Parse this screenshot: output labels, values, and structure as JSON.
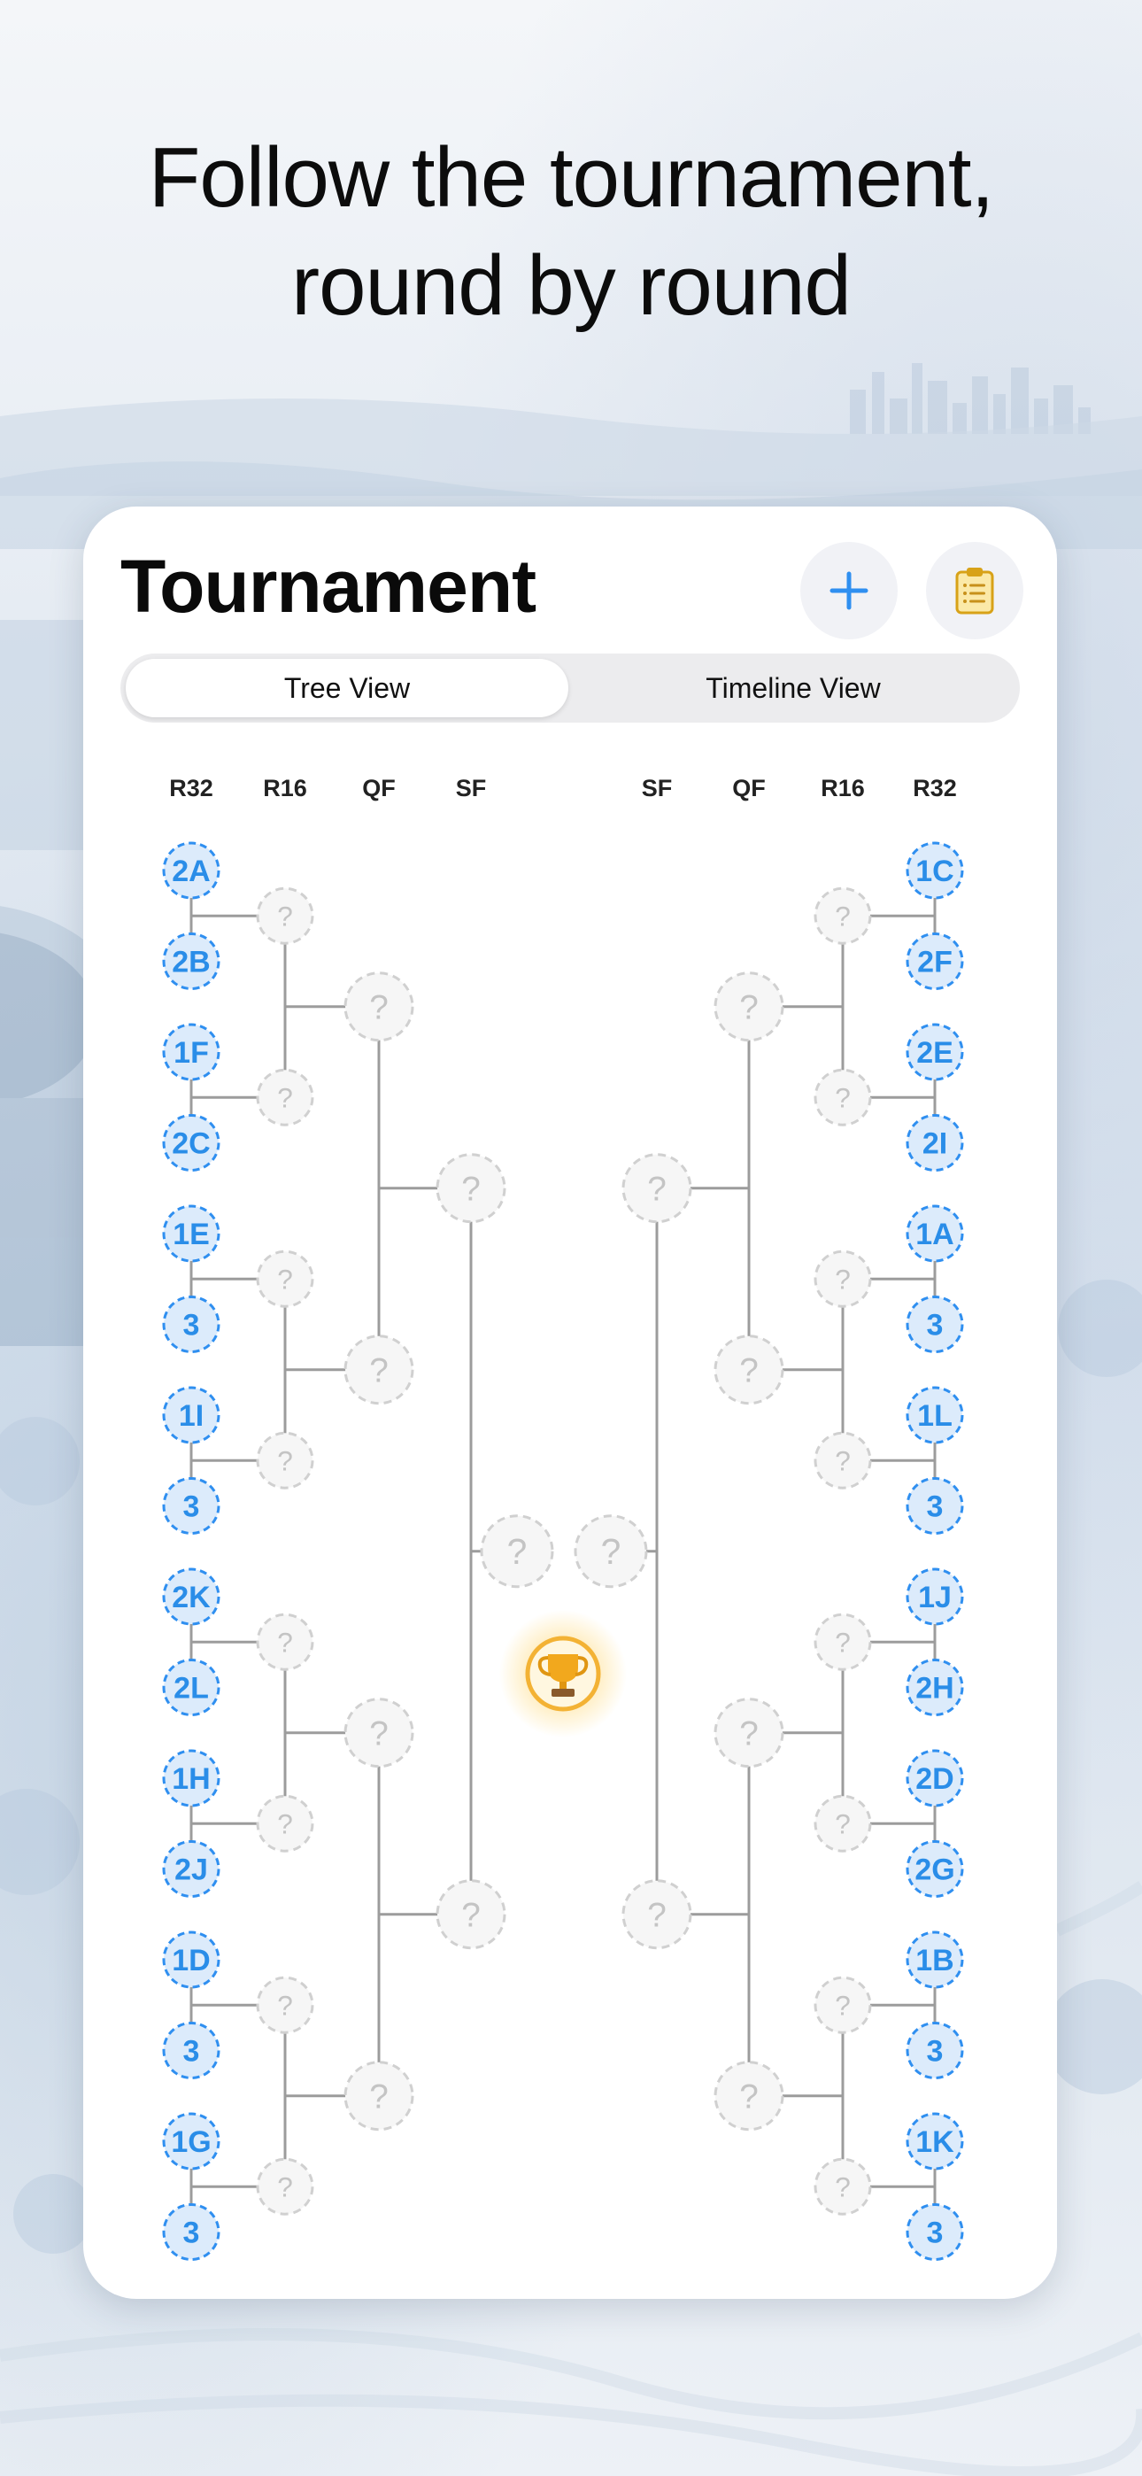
{
  "headline": {
    "line1": "Follow the tournament,",
    "line2": "round by round"
  },
  "card": {
    "title": "Tournament"
  },
  "buttons": {
    "add_icon": "plus-icon",
    "clipboard_icon": "clipboard-icon"
  },
  "segmented": {
    "tree": "Tree View",
    "timeline": "Timeline View",
    "selected": "Tree View"
  },
  "colors": {
    "accent": "#2f8ff0",
    "team_fill": "#dcebfb",
    "team_text": "#2a8de8",
    "unknown": "#c4c4c4",
    "line": "#9c9c9c",
    "trophy": "#f3b234"
  },
  "bracket": {
    "round_labels_left": [
      "R32",
      "R16",
      "QF",
      "SF"
    ],
    "round_labels_right": [
      "SF",
      "QF",
      "R16",
      "R32"
    ],
    "left_r32": [
      "2A",
      "2B",
      "1F",
      "2C",
      "1E",
      "3",
      "1I",
      "3",
      "2K",
      "2L",
      "1H",
      "2J",
      "1D",
      "3",
      "1G",
      "3"
    ],
    "right_r32": [
      "1C",
      "2F",
      "2E",
      "2I",
      "1A",
      "3",
      "1L",
      "3",
      "1J",
      "2H",
      "2D",
      "2G",
      "1B",
      "3",
      "1K",
      "3"
    ],
    "unknown_label": "?",
    "champion_icon": "trophy-icon"
  }
}
